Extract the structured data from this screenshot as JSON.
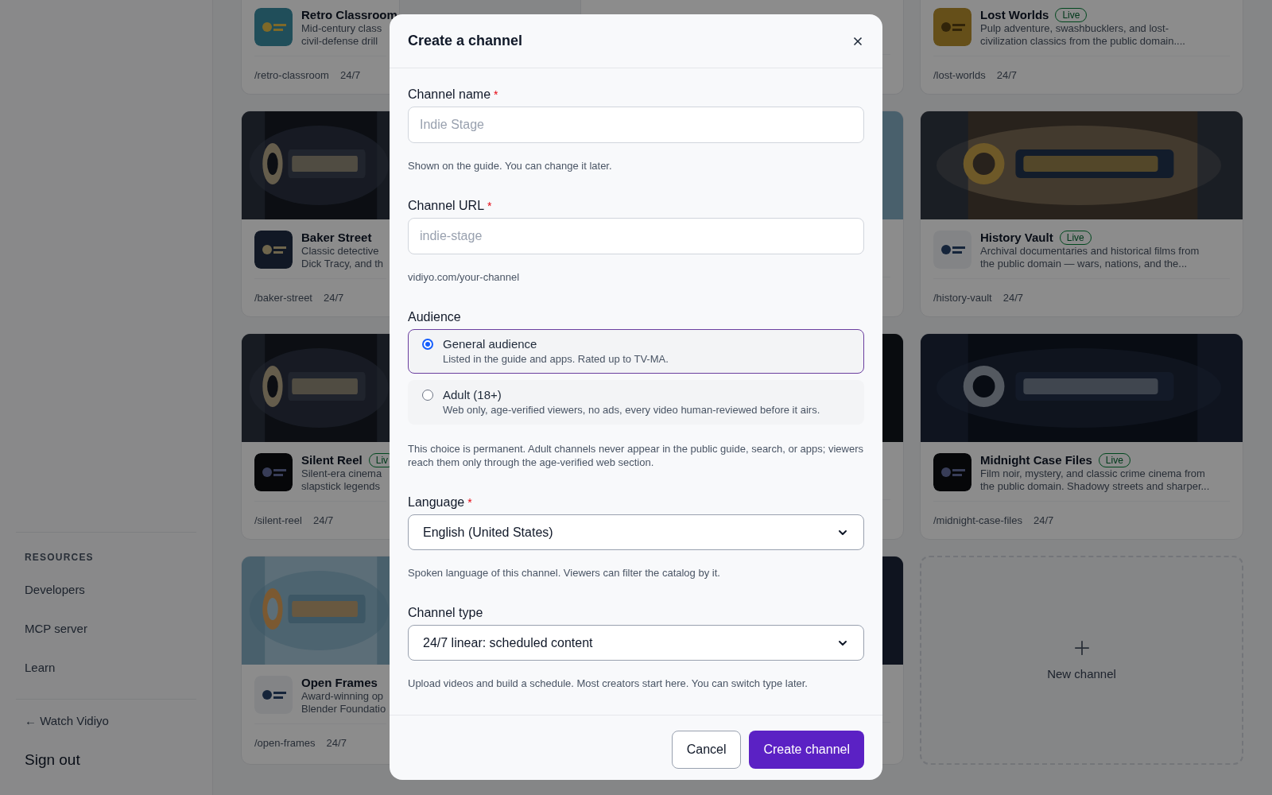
{
  "sidebar": {
    "sections": [
      {
        "heading": "RESOURCES",
        "items": [
          "Developers",
          "MCP server",
          "Learn"
        ]
      }
    ],
    "back_link": "← Watch Vidiyo",
    "sign_out": "Sign out"
  },
  "channels": [
    {
      "kind": "scrolled",
      "title": "Retro Classroom",
      "description": [
        "Mid-century class",
        "civil-defense drill"
      ],
      "path": "/retro-classroom",
      "schedule": "24/7"
    },
    {
      "kind": "scrolled"
    },
    {
      "kind": "scrolled",
      "title": "Lost Worlds",
      "badge": "Live",
      "description": [
        "Pulp adventure, swashbucklers, and lost-",
        "civilization classics from the public domain...."
      ],
      "path": "/lost-worlds",
      "schedule": "24/7"
    },
    {
      "kind": "banner",
      "title": "Baker Street",
      "description": [
        "Classic detective",
        "Dick Tracy, and th"
      ],
      "path": "/baker-street",
      "schedule": "24/7"
    },
    {
      "kind": "banner"
    },
    {
      "kind": "banner",
      "title": "History Vault",
      "badge": "Live",
      "description": [
        "Archival documentaries and historical films from",
        "the public domain — wars, nations, and the..."
      ],
      "path": "/history-vault",
      "schedule": "24/7"
    },
    {
      "kind": "banner",
      "title": "Silent Reel",
      "badge": "Liv",
      "description": [
        "Silent-era cinema",
        "slapstick legends"
      ],
      "path": "/silent-reel",
      "schedule": "24/7"
    },
    {
      "kind": "banner"
    },
    {
      "kind": "banner",
      "title": "Midnight Case Files",
      "badge": "Live",
      "description": [
        "Film noir, mystery, and classic crime cinema from",
        "the public domain. Shadowy streets and sharper..."
      ],
      "path": "/midnight-case-files",
      "schedule": "24/7"
    },
    {
      "kind": "banner",
      "title": "Open Frames",
      "description": [
        "Award-winning op",
        "Blender Foundatio"
      ],
      "path": "/open-frames",
      "schedule": "24/7"
    },
    {
      "kind": "banner"
    }
  ],
  "new_channel_card": {
    "label": "New channel"
  },
  "dialog": {
    "title": "Create a channel",
    "fields": [
      {
        "kind": "text",
        "label": "Channel name",
        "required_mark": "*",
        "placeholder": "Indie Stage",
        "helper": "Shown on the guide. You can change it later."
      },
      {
        "kind": "text",
        "label": "Channel URL",
        "required_mark": "*",
        "placeholder": "indie-stage",
        "helper": "vidiyo.com/your-channel"
      },
      {
        "kind": "radio",
        "label": "Audience",
        "options": [
          {
            "title": "General audience",
            "description": "Listed in the guide and apps. Rated up to TV-MA.",
            "selected": true
          },
          {
            "title": "Adult (18+)",
            "description": "Web only, age-verified viewers, no ads, every video human-reviewed before it airs.",
            "selected": false
          }
        ],
        "helper": "This choice is permanent. Adult channels never appear in the public guide, search, or apps; viewers reach them only through the age-verified web section."
      },
      {
        "kind": "select",
        "label": "Language",
        "required_mark": "*",
        "value": "English (United States)",
        "helper": "Spoken language of this channel. Viewers can filter the catalog by it."
      },
      {
        "kind": "select",
        "label": "Channel type",
        "value": "24/7 linear: scheduled content",
        "helper": "Upload videos and build a schedule. Most creators start here. You can switch type later."
      }
    ],
    "buttons": [
      {
        "kind": "secondary",
        "label": "Cancel"
      },
      {
        "kind": "primary",
        "label": "Create channel"
      }
    ]
  }
}
